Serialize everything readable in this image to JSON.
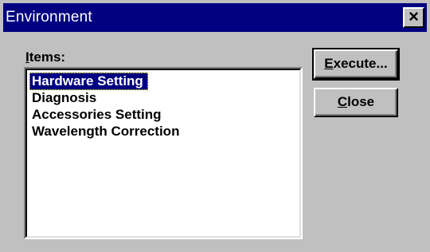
{
  "window": {
    "title": "Environment",
    "close_glyph": "×"
  },
  "items": {
    "label": "Items:",
    "list": [
      {
        "label": "Hardware Setting",
        "selected": true
      },
      {
        "label": "Diagnosis",
        "selected": false
      },
      {
        "label": "Accessories Setting",
        "selected": false
      },
      {
        "label": "Wavelength Correction",
        "selected": false
      }
    ]
  },
  "buttons": {
    "execute": "Execute...",
    "close": "Close"
  },
  "colors": {
    "titlebar": "#000080",
    "face": "#c0c0c0",
    "selection": "#000080"
  }
}
